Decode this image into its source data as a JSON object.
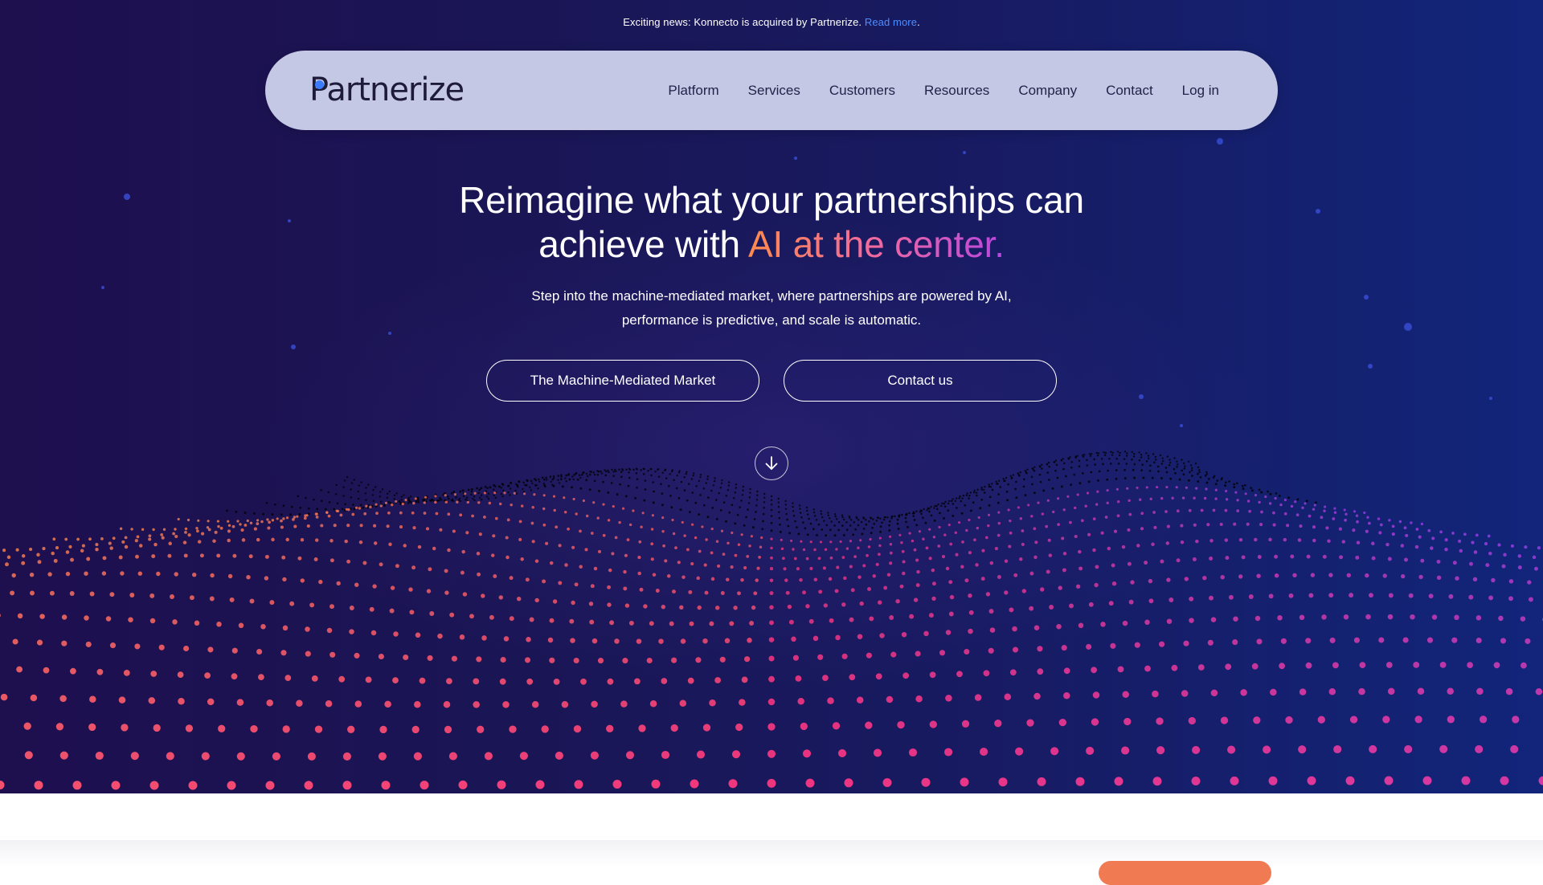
{
  "announcement": {
    "text": "Exciting news: Konnecto is acquired by Partnerize.",
    "link_label": "Read more",
    "suffix": "."
  },
  "brand": {
    "name": "Partnerize",
    "logo_icon": "partnerize-logo-icon"
  },
  "nav": {
    "items": [
      {
        "label": "Platform"
      },
      {
        "label": "Services"
      },
      {
        "label": "Customers"
      },
      {
        "label": "Resources"
      },
      {
        "label": "Company"
      },
      {
        "label": "Contact"
      },
      {
        "label": "Log in"
      }
    ]
  },
  "hero": {
    "headline_line1": "Reimagine what your partnerships can",
    "headline_line2_plain": "achieve with",
    "headline_line2_highlight": "AI at the center.",
    "subtext_line1": "Step into the machine-mediated market, where partnerships are powered by AI,",
    "subtext_line2": "performance is predictive, and scale is automatic.",
    "primary_button": "The Machine-Mediated Market",
    "secondary_button": "Contact us",
    "scroll_icon": "arrow-down-icon"
  },
  "colors": {
    "hero_bg_left": "#1e0f4f",
    "hero_bg_right": "#12257a",
    "nav_bg": "#c5c8e4",
    "link_blue": "#4c8dff",
    "accent_orange": "#ff8a4c",
    "accent_pink": "#f0357f",
    "accent_purple": "#b846e0"
  }
}
